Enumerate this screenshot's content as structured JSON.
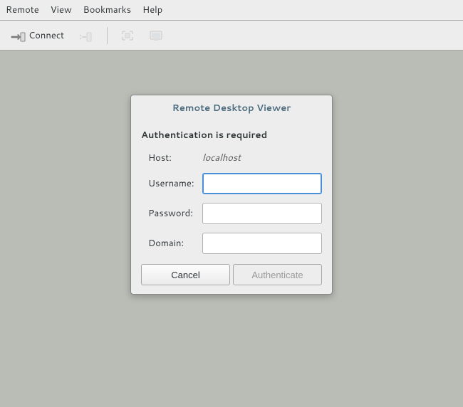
{
  "menubar": {
    "remote": "Remote",
    "view": "View",
    "bookmarks": "Bookmarks",
    "help": "Help"
  },
  "toolbar": {
    "connect_label": "Connect"
  },
  "dialog": {
    "title": "Remote Desktop Viewer",
    "heading": "Authentication is required",
    "host_label": "Host:",
    "host_value": "localhost",
    "username_label": "Username:",
    "username_value": "",
    "password_label": "Password:",
    "password_value": "",
    "domain_label": "Domain:",
    "domain_value": "",
    "cancel_label": "Cancel",
    "authenticate_label": "Authenticate"
  }
}
